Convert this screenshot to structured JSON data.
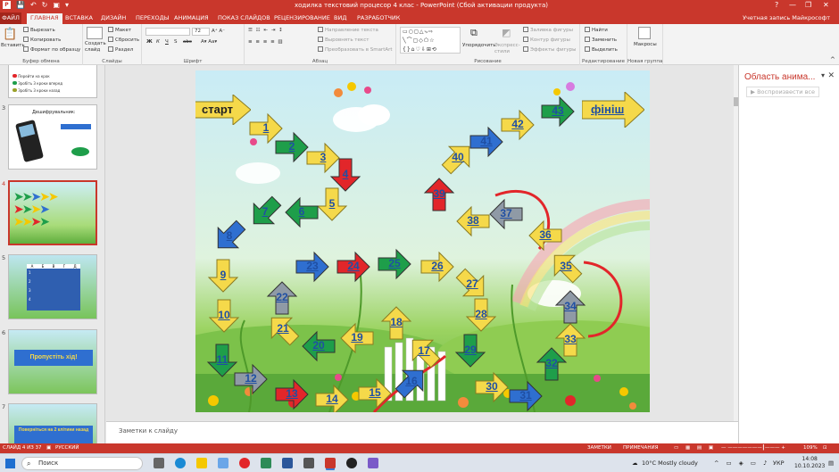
{
  "window": {
    "title": "ходилка текстовий процесор 4 клас - PowerPoint (Сбой активации продукта)",
    "help": "?",
    "minimize": "—",
    "restore": "❐",
    "close": "✕"
  },
  "tabs": {
    "file": "ФАЙЛ",
    "items": [
      "ГЛАВНАЯ",
      "ВСТАВКА",
      "ДИЗАЙН",
      "ПЕРЕХОДЫ",
      "АНИМАЦИЯ",
      "ПОКАЗ СЛАЙДОВ",
      "РЕЦЕНЗИРОВАНИЕ",
      "ВИД",
      "РАЗРАБОТЧИК"
    ],
    "active": "ГЛАВНАЯ",
    "account": "Учетная запись Майкрософт"
  },
  "ribbon": {
    "clipboard": {
      "paste": "Вставить",
      "cut": "Вырезать",
      "copy": "Копировать",
      "format": "Формат по образцу",
      "label": "Буфер обмена"
    },
    "slides": {
      "new": "Создать слайд",
      "layout": "Макет",
      "reset": "Сбросить",
      "section": "Раздел",
      "label": "Слайды"
    },
    "font": {
      "size": "72",
      "bold": "Ж",
      "italic": "К",
      "underline": "Ч",
      "shadow": "S",
      "strike": "abc",
      "label": "Шрифт"
    },
    "paragraph": {
      "direction": "Направление текста",
      "align": "Выровнять текст",
      "smartart": "Преобразовать в SmartArt",
      "label": "Абзац"
    },
    "drawing": {
      "arrange": "Упорядочить",
      "styles": "Экспресс-стили",
      "fill": "Заливка фигуры",
      "outline": "Контур фигуры",
      "effects": "Эффекты фигуры",
      "label": "Рисование"
    },
    "editing": {
      "find": "Найти",
      "replace": "Заменить",
      "select": "Выделить",
      "label": "Редактирование"
    },
    "new_group": {
      "macros": "Макросы",
      "label": "Новая группа"
    }
  },
  "slides_panel": {
    "numbers": [
      "3",
      "4",
      "5",
      "6",
      "7"
    ],
    "slide3_title": "Дешифрувальник:",
    "slide6_text": "Пропустіть хід!",
    "slide7_text": "Поверніться на 2 клітини назад",
    "slide2_legend": [
      "Перейти на крок",
      "Зробіть 3 кроки вперед",
      "Зробіть 3 кроки назад"
    ],
    "table_headers": [
      "А",
      "Б",
      "В",
      "Г",
      "Д"
    ],
    "table_rows": [
      "1",
      "2",
      "3",
      "4"
    ]
  },
  "slide": {
    "start": "старт",
    "finish": "фініш",
    "colors": {
      "yellow": "#f5d94a",
      "green": "#1e9e4a",
      "blue": "#2f6fd0",
      "red": "#e2262a",
      "gray": "#8f9aa6"
    },
    "steps": [
      {
        "label": "1",
        "color": "yellow",
        "dir": "right"
      },
      {
        "label": "2",
        "color": "green",
        "dir": "right"
      },
      {
        "label": "3",
        "color": "yellow",
        "dir": "right"
      },
      {
        "label": "4",
        "color": "red",
        "dir": "down"
      },
      {
        "label": "5",
        "color": "yellow",
        "dir": "down"
      },
      {
        "label": "6",
        "color": "green",
        "dir": "left"
      },
      {
        "label": "7",
        "color": "green",
        "dir": "down-left"
      },
      {
        "label": "8",
        "color": "blue",
        "dir": "down-left"
      },
      {
        "label": "9",
        "color": "yellow",
        "dir": "down"
      },
      {
        "label": "10",
        "color": "yellow",
        "dir": "down"
      },
      {
        "label": "11",
        "color": "green",
        "dir": "down"
      },
      {
        "label": "12",
        "color": "gray",
        "dir": "right"
      },
      {
        "label": "13",
        "color": "red",
        "dir": "right"
      },
      {
        "label": "14",
        "color": "yellow",
        "dir": "right"
      },
      {
        "label": "15",
        "color": "yellow",
        "dir": "right"
      },
      {
        "label": "16",
        "color": "blue",
        "dir": "up-right"
      },
      {
        "label": "17",
        "color": "yellow",
        "dir": "up-left"
      },
      {
        "label": "18",
        "color": "yellow",
        "dir": "up"
      },
      {
        "label": "19",
        "color": "yellow",
        "dir": "left"
      },
      {
        "label": "20",
        "color": "green",
        "dir": "left"
      },
      {
        "label": "21",
        "color": "yellow",
        "dir": "up-left"
      },
      {
        "label": "22",
        "color": "gray",
        "dir": "up"
      },
      {
        "label": "23",
        "color": "blue",
        "dir": "right"
      },
      {
        "label": "24",
        "color": "red",
        "dir": "right"
      },
      {
        "label": "25",
        "color": "green",
        "dir": "right"
      },
      {
        "label": "26",
        "color": "yellow",
        "dir": "right"
      },
      {
        "label": "27",
        "color": "yellow",
        "dir": "down-right"
      },
      {
        "label": "28",
        "color": "yellow",
        "dir": "down"
      },
      {
        "label": "29",
        "color": "green",
        "dir": "down"
      },
      {
        "label": "30",
        "color": "yellow",
        "dir": "right"
      },
      {
        "label": "31",
        "color": "blue",
        "dir": "right"
      },
      {
        "label": "32",
        "color": "green",
        "dir": "up"
      },
      {
        "label": "33",
        "color": "yellow",
        "dir": "up"
      },
      {
        "label": "34",
        "color": "gray",
        "dir": "up"
      },
      {
        "label": "35",
        "color": "yellow",
        "dir": "up-left"
      },
      {
        "label": "36",
        "color": "yellow",
        "dir": "left"
      },
      {
        "label": "37",
        "color": "gray",
        "dir": "left"
      },
      {
        "label": "38",
        "color": "yellow",
        "dir": "left"
      },
      {
        "label": "39",
        "color": "red",
        "dir": "up"
      },
      {
        "label": "40",
        "color": "yellow",
        "dir": "up-right"
      },
      {
        "label": "41",
        "color": "blue",
        "dir": "right"
      },
      {
        "label": "42",
        "color": "yellow",
        "dir": "right"
      },
      {
        "label": "43",
        "color": "green",
        "dir": "right"
      }
    ]
  },
  "notes": {
    "placeholder": "Заметки к слайду"
  },
  "animation_pane": {
    "title": "Область анима...",
    "play": "Воспроизвести все"
  },
  "status": {
    "slide": "СЛАЙД 4 ИЗ 37",
    "language": "РУССКИЙ",
    "notes": "ЗАМЕТКИ",
    "comments": "ПРИМЕЧАНИЯ",
    "zoom": "109%"
  },
  "taskbar": {
    "search": "Поиск",
    "weather": "10°C  Mostly cloudy",
    "lang": "УКР",
    "time": "14:08",
    "date": "10.10.2023"
  }
}
